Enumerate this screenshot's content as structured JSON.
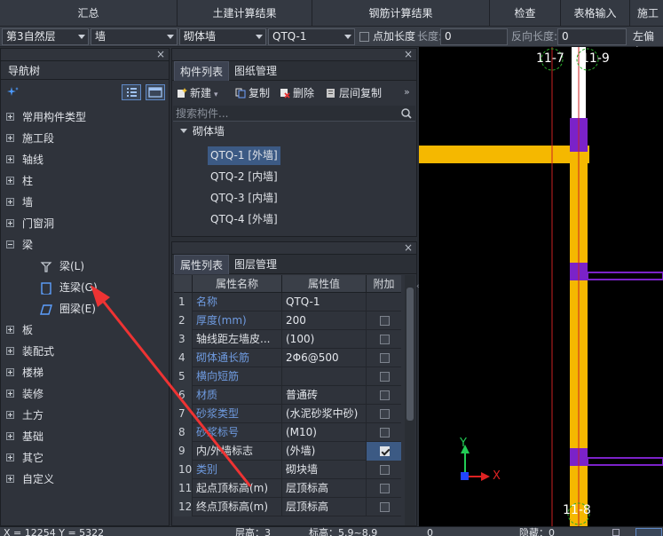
{
  "menu": {
    "items": [
      "汇总",
      "土建计算结果",
      "钢筋计算结果",
      "检查",
      "表格输入",
      "施工"
    ]
  },
  "toolbar": {
    "floor": "第3自然层",
    "category": "墙",
    "type": "砌体墙",
    "component": "QTQ-1",
    "add_length_label": "点加长度",
    "length_label": "长度:",
    "length_value": "0",
    "reverse_length_label": "反向长度:",
    "reverse_length_value": "0",
    "offset_label": "左偏心"
  },
  "nav": {
    "title": "导航树",
    "items": [
      {
        "label": "常用构件类型",
        "expanded": false
      },
      {
        "label": "施工段",
        "expanded": false
      },
      {
        "label": "轴线",
        "expanded": false
      },
      {
        "label": "柱",
        "expanded": false
      },
      {
        "label": "墙",
        "expanded": false
      },
      {
        "label": "门窗洞",
        "expanded": false
      },
      {
        "label": "梁",
        "expanded": true
      },
      {
        "label": "梁(L)",
        "child": true,
        "icon": "beam-icon"
      },
      {
        "label": "连梁(G)",
        "child": true,
        "icon": "coupling-beam-icon"
      },
      {
        "label": "圈梁(E)",
        "child": true,
        "icon": "ring-beam-icon"
      },
      {
        "label": "板",
        "expanded": false
      },
      {
        "label": "装配式",
        "expanded": false
      },
      {
        "label": "楼梯",
        "expanded": false
      },
      {
        "label": "装修",
        "expanded": false
      },
      {
        "label": "土方",
        "expanded": false
      },
      {
        "label": "基础",
        "expanded": false
      },
      {
        "label": "其它",
        "expanded": false
      },
      {
        "label": "自定义",
        "expanded": false
      }
    ]
  },
  "component_panel": {
    "tabs": [
      "构件列表",
      "图纸管理"
    ],
    "buttons": {
      "new": "新建",
      "copy": "复制",
      "delete": "删除",
      "floor_copy": "层间复制"
    },
    "search_placeholder": "搜索构件...",
    "group": "砌体墙",
    "items": [
      "QTQ-1 [外墙]",
      "QTQ-2 [内墙]",
      "QTQ-3 [内墙]",
      "QTQ-4 [外墙]"
    ]
  },
  "property_panel": {
    "tabs": [
      "属性列表",
      "图层管理"
    ],
    "headers": [
      "属性名称",
      "属性值",
      "附加"
    ],
    "rows": [
      {
        "n": "1",
        "name": "名称",
        "value": "QTQ-1",
        "blue": true,
        "check": null
      },
      {
        "n": "2",
        "name": "厚度(mm)",
        "value": "200",
        "blue": true,
        "check": false
      },
      {
        "n": "3",
        "name": "轴线距左墙皮...",
        "value": "(100)",
        "blue": false,
        "check": false
      },
      {
        "n": "4",
        "name": "砌体通长筋",
        "value": "2Φ6@500",
        "blue": true,
        "check": false
      },
      {
        "n": "5",
        "name": "横向短筋",
        "value": "",
        "blue": true,
        "check": false
      },
      {
        "n": "6",
        "name": "材质",
        "value": "普通砖",
        "blue": true,
        "check": false
      },
      {
        "n": "7",
        "name": "砂浆类型",
        "value": "(水泥砂浆中砂)",
        "blue": true,
        "check": false
      },
      {
        "n": "8",
        "name": "砂浆标号",
        "value": "(M10)",
        "blue": true,
        "check": false
      },
      {
        "n": "9",
        "name": "内/外墙标志",
        "value": "(外墙)",
        "blue": false,
        "check": true
      },
      {
        "n": "10",
        "name": "类别",
        "value": "砌块墙",
        "blue": true,
        "check": false
      },
      {
        "n": "11",
        "name": "起点顶标高(m)",
        "value": "层顶标高",
        "blue": false,
        "check": false
      },
      {
        "n": "12",
        "name": "终点顶标高(m)",
        "value": "层顶标高",
        "blue": false,
        "check": false
      }
    ]
  },
  "canvas": {
    "labels": {
      "top_left": "11-7",
      "top_right": "11-9",
      "bottom": "11-8",
      "axis_x": "X",
      "axis_y": "Y"
    }
  },
  "status": {
    "coords": "X = 12254 Y = 5322",
    "floor_height": "层高：3",
    "elevation": "标高：5.9~8.9",
    "count": "0",
    "hidden": "隐藏：0"
  },
  "colors": {
    "wall": "#f5b800",
    "column": "#7b22c9",
    "axis": "#cc2222",
    "select": "#3c5a84"
  }
}
